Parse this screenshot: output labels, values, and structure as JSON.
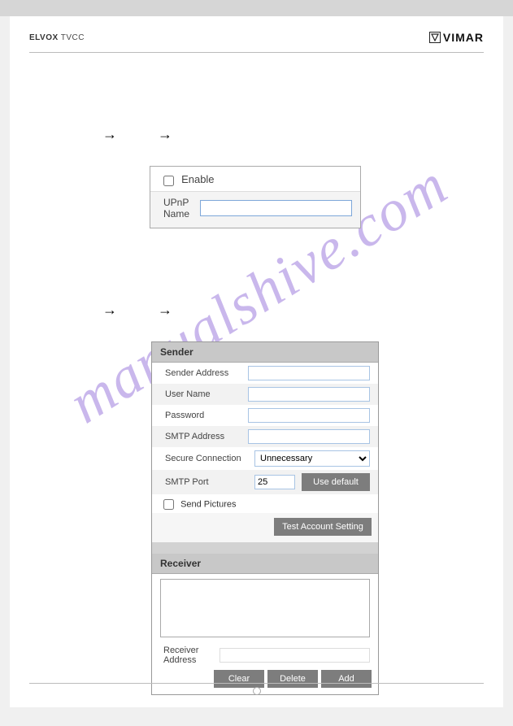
{
  "header": {
    "brand_bold": "ELVOX",
    "brand_light": "TVCC",
    "logo_text": "VIMAR"
  },
  "watermark": "manualshive.com",
  "upnp": {
    "enable_label": "Enable",
    "name_label": "UPnP Name",
    "name_value": ""
  },
  "email": {
    "sender_title": "Sender",
    "fields": {
      "sender_address": "Sender Address",
      "user_name": "User Name",
      "password": "Password",
      "smtp_address": "SMTP Address",
      "secure_connection": "Secure Connection",
      "smtp_port": "SMTP Port"
    },
    "values": {
      "sender_address": "",
      "user_name": "",
      "password": "",
      "smtp_address": "",
      "secure_connection": "Unnecessary",
      "smtp_port": "25"
    },
    "secure_options": [
      "Unnecessary"
    ],
    "use_default_btn": "Use default",
    "send_pictures_label": "Send Pictures",
    "test_btn": "Test Account Setting",
    "receiver_title": "Receiver",
    "receiver_address_label": "Receiver Address",
    "receiver_address_value": "",
    "buttons": {
      "clear": "Clear",
      "delete": "Delete",
      "add": "Add"
    }
  }
}
